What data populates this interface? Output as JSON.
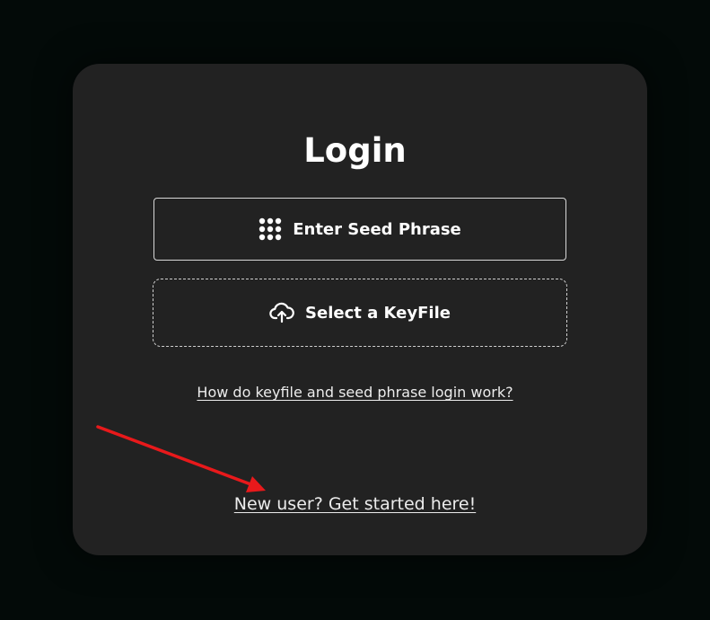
{
  "login": {
    "title": "Login",
    "seed_button_label": "Enter Seed Phrase",
    "keyfile_button_label": "Select a KeyFile",
    "help_link": "How do keyfile and seed phrase login work?",
    "new_user_link": "New user? Get started here!"
  },
  "icons": {
    "seed_button": "grid-dots-icon",
    "keyfile_button": "cloud-upload-icon",
    "annotation": "red-arrow-annotation"
  },
  "colors": {
    "page_background": "#030a08",
    "card_background": "#222222",
    "text": "#ffffff",
    "annotation_arrow": "#e8191b"
  }
}
